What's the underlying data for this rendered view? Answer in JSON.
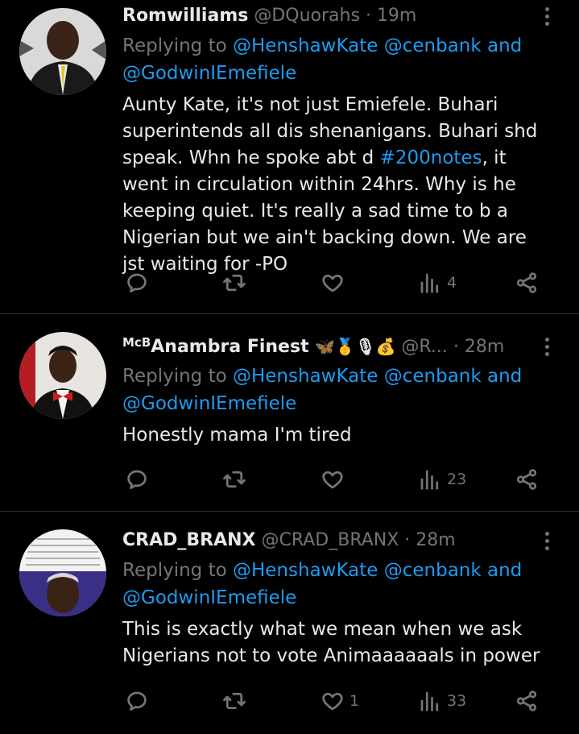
{
  "tweets": [
    {
      "display_name": "Romwilliams",
      "handle": "@DQuorahs",
      "time": "19m",
      "reply_prefix": "Replying to",
      "mention_1": "@HenshawKate",
      "mention_2": "@cenbank",
      "and_word": "and",
      "mention_3": "@GodwinIEmefiele",
      "body_part1": "Aunty Kate, it's not just Emiefele. Buhari superintends all dis shenanigans. Buhari shd speak. Whn he spoke abt d ",
      "hashtag": "#200notes",
      "body_part2": ", it went in circulation within 24hrs. Why is he keeping quiet. It's really a sad time to b a Nigerian but we ain't backing down. We are jst waiting for -PO",
      "likes": "",
      "views": "4"
    },
    {
      "name_prefix": "McB",
      "display_name": "Anambra Finest",
      "name_emojis": "🦋🥇🎙💰",
      "handle": "@R...",
      "time": "28m",
      "reply_prefix": "Replying to",
      "mention_1": "@HenshawKate",
      "mention_2": "@cenbank",
      "and_word": "and",
      "mention_3": "@GodwinIEmefiele",
      "body": "Honestly mama I'm tired",
      "likes": "",
      "views": "23"
    },
    {
      "display_name": "CRAD_BRANX",
      "handle": "@CRAD_BRANX",
      "time": "28m",
      "reply_prefix": "Replying to",
      "mention_1": "@HenshawKate",
      "mention_2": "@cenbank",
      "and_word": "and",
      "mention_3": "@GodwinIEmefiele",
      "body": "This is exactly what we mean when we ask Nigerians not to vote Animaaaaaals in power",
      "likes": "1",
      "views": "33"
    }
  ],
  "dot": "·",
  "icons": [
    "reply-icon",
    "retweet-icon",
    "like-icon",
    "views-icon",
    "share-icon",
    "more-icon"
  ],
  "colors": {
    "background": "#000000",
    "text": "#e7e9ea",
    "muted": "#71767b",
    "link": "#1d9bf0",
    "divider": "#2f3336"
  }
}
